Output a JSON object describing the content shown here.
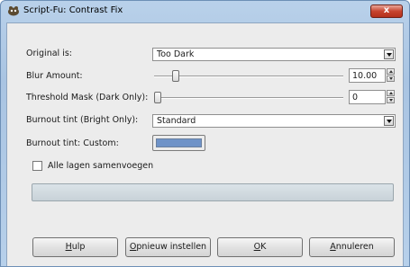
{
  "window": {
    "title": "Script-Fu: Contrast Fix",
    "close_label": "x"
  },
  "form": {
    "original": {
      "label": "Original is:",
      "value": "Too Dark"
    },
    "blur": {
      "label": "Blur Amount:",
      "value": "10.00",
      "level_fraction": 0.1
    },
    "threshold": {
      "label": "Threshold Mask (Dark Only):",
      "value": "0",
      "level_fraction": 0.0
    },
    "burnout_tint": {
      "label": "Burnout tint (Bright Only):",
      "value": "Standard"
    },
    "burnout_custom": {
      "label": "Burnout tint: Custom:",
      "color": "#6f93c8"
    },
    "merge_layers": {
      "label": "Alle lagen samenvoegen",
      "checked": false
    }
  },
  "progress": {
    "value_fraction": 0
  },
  "buttons": {
    "help": {
      "label": "Hulp",
      "accel": "H",
      "rest": "ulp"
    },
    "reset": {
      "label": "Opnieuw instellen",
      "accel": "O",
      "rest": "pnieuw instellen"
    },
    "ok": {
      "label": "OK",
      "accel": "O",
      "rest": "K"
    },
    "cancel": {
      "label": "Annuleren",
      "accel": "A",
      "rest": "nnuleren"
    }
  }
}
